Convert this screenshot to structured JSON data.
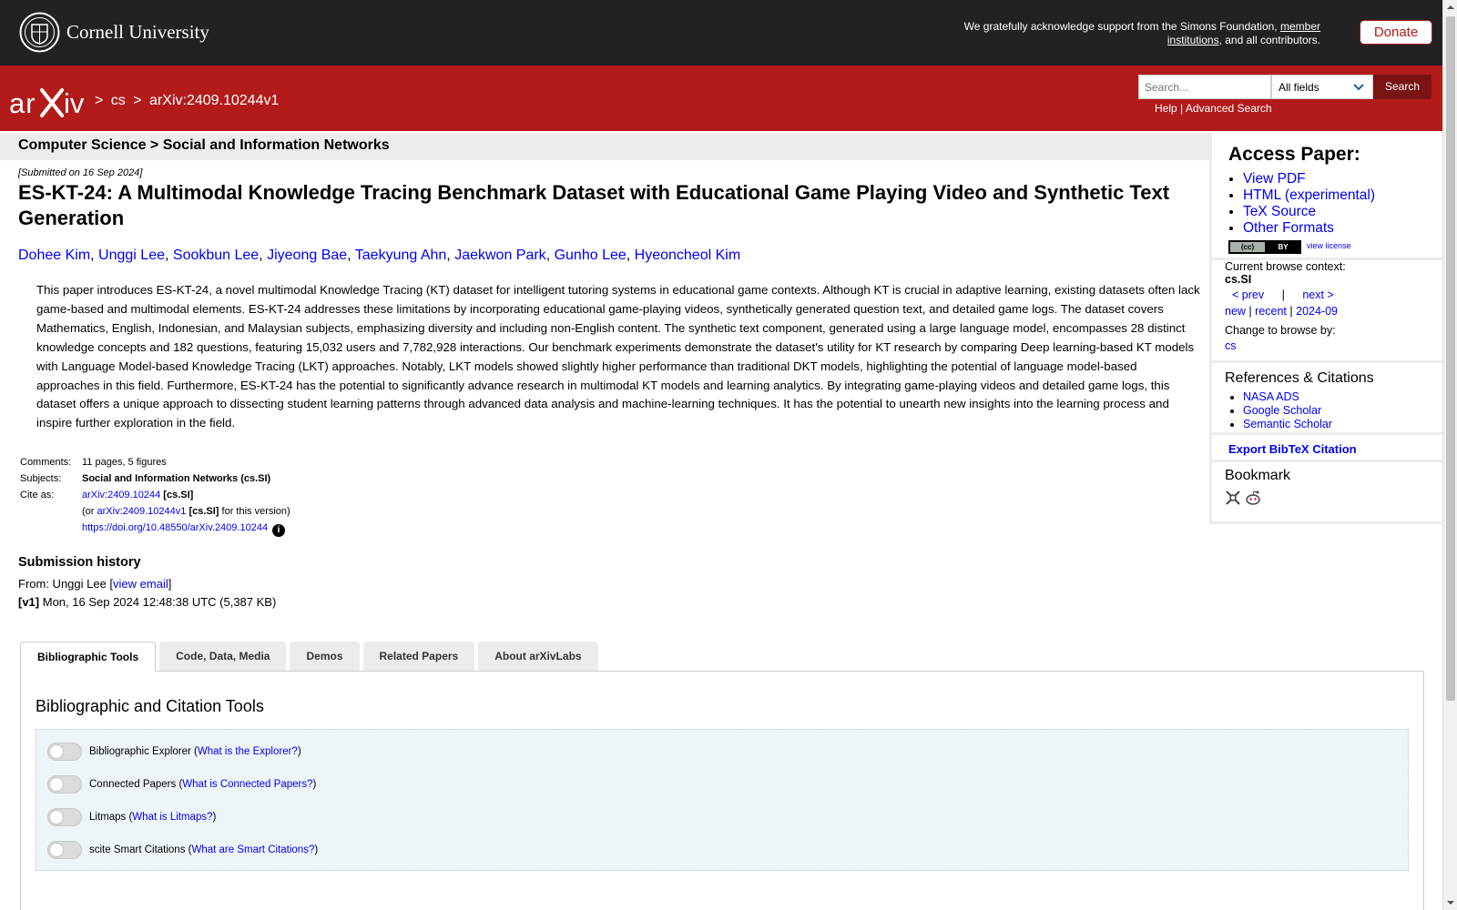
{
  "header": {
    "institution": "Cornell University",
    "ack_text": "We gratefully acknowledge support from the Simons Foundation,",
    "ack_link": "member institutions",
    "ack_tail": ", and all contributors.",
    "donate_label": "Donate"
  },
  "nav": {
    "logo_alt": "arXiv",
    "crumb_sep1": ">",
    "crumb_cs": "cs",
    "crumb_sep2": ">",
    "crumb_id": "arXiv:2409.10244v1",
    "search_placeholder": "Search...",
    "search_field": "All fields",
    "search_button": "Search",
    "help": "Help",
    "pipe": "|",
    "advanced": "Advanced Search"
  },
  "subject_header": "Computer Science > Social and Information Networks",
  "paper": {
    "submitted": "[Submitted on 16 Sep 2024]",
    "title": "ES-KT-24: A Multimodal Knowledge Tracing Benchmark Dataset with Educational Game Playing Video and Synthetic Text Generation",
    "authors": [
      "Dohee Kim",
      "Unggi Lee",
      "Sookbun Lee",
      "Jiyeong Bae",
      "Taekyung Ahn",
      "Jaekwon Park",
      "Gunho Lee",
      "Hyeoncheol Kim"
    ],
    "author_sep": ", ",
    "abstract": "This paper introduces ES-KT-24, a novel multimodal Knowledge Tracing (KT) dataset for intelligent tutoring systems in educational game contexts. Although KT is crucial in adaptive learning, existing datasets often lack game-based and multimodal elements. ES-KT-24 addresses these limitations by incorporating educational game-playing videos, synthetically generated question text, and detailed game logs. The dataset covers Mathematics, English, Indonesian, and Malaysian subjects, emphasizing diversity and including non-English content. The synthetic text component, generated using a large language model, encompasses 28 distinct knowledge concepts and 182 questions, featuring 15,032 users and 7,782,928 interactions. Our benchmark experiments demonstrate the dataset's utility for KT research by comparing Deep learning-based KT models with Language Model-based Knowledge Tracing (LKT) approaches. Notably, LKT models showed slightly higher performance than traditional DKT models, highlighting the potential of language model-based approaches in this field. Furthermore, ES-KT-24 has the potential to significantly advance research in multimodal KT models and learning analytics. By integrating game-playing videos and detailed game logs, this dataset offers a unique approach to dissecting student learning patterns through advanced data analysis and machine-learning techniques. It has the potential to unearth new insights into the learning process and inspire further exploration in the field."
  },
  "metadata": {
    "comments_label": "Comments:",
    "comments": "11 pages, 5 figures",
    "subjects_label": "Subjects:",
    "subjects": "Social and Information Networks (cs.SI)",
    "cite_label": "Cite as:",
    "cite_id": "arXiv:2409.10244",
    "cite_tag": "[cs.SI]",
    "cite_or": "(or",
    "cite_version_id": "arXiv:2409.10244v1",
    "cite_version_tag": "[cs.SI]",
    "cite_version_tail": "for this version)",
    "doi": "https://doi.org/10.48550/arXiv.2409.10244",
    "info_glyph": "i"
  },
  "history": {
    "heading": "Submission history",
    "from_label": "From: Unggi Lee [",
    "view_email": "view email",
    "from_close": "]",
    "version": "[v1]",
    "version_detail": "Mon, 16 Sep 2024 12:48:38 UTC (5,387 KB)"
  },
  "tabs": [
    "Bibliographic Tools",
    "Code, Data, Media",
    "Demos",
    "Related Papers",
    "About arXivLabs"
  ],
  "tools": {
    "heading": "Bibliographic and Citation Tools",
    "items": [
      {
        "label": "Bibliographic Explorer (",
        "link": "What is the Explorer?",
        "close": ")"
      },
      {
        "label": "Connected Papers (",
        "link": "What is Connected Papers?",
        "close": ")"
      },
      {
        "label": "Litmaps (",
        "link": "What is Litmaps?",
        "close": ")"
      },
      {
        "label": "scite Smart Citations (",
        "link": "What are Smart Citations?",
        "close": ")"
      }
    ]
  },
  "sidebar": {
    "access_heading": "Access Paper:",
    "access_links": [
      "View PDF",
      "HTML (experimental)",
      "TeX Source",
      "Other Formats"
    ],
    "license_cc": "(cc)",
    "license_by": "BY",
    "view_license": "view license",
    "browse_context_label": "Current browse context:",
    "browse_context": "cs.SI",
    "prev": "< prev",
    "pipe": "|",
    "next": "next >",
    "new": "new",
    "recent": "recent",
    "month": "2024-09",
    "change_label": "Change to browse by:",
    "change_cs": "cs",
    "refs_heading": "References & Citations",
    "refs": [
      "NASA ADS",
      "Google Scholar",
      "Semantic Scholar"
    ],
    "bibtex": "Export BibTeX Citation",
    "bookmark_heading": "Bookmark"
  },
  "colors": {
    "arxiv_red": "#b31b1b",
    "top_dark": "#222222",
    "link_blue": "#0000ee"
  }
}
